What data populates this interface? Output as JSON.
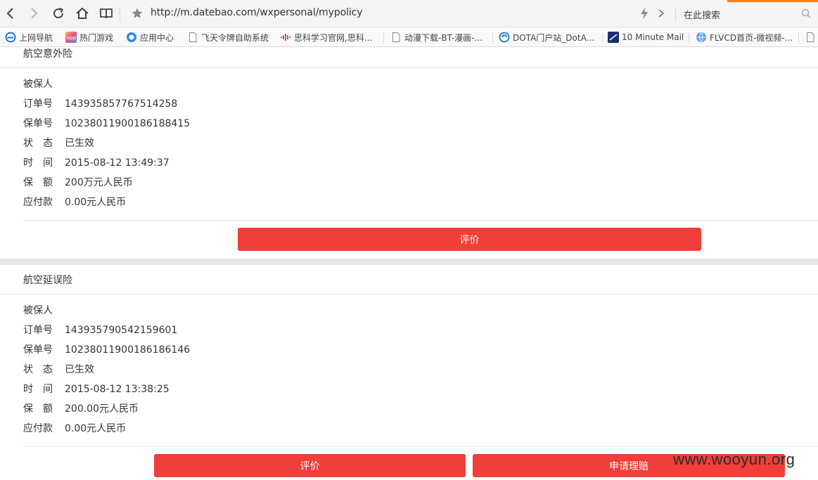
{
  "browser": {
    "url": "http://m.datebao.com/wxpersonal/mypolicy",
    "search_placeholder": "在此搜索",
    "bookmarks": [
      {
        "label": "上网导航",
        "icon": "ie-icon"
      },
      {
        "label": "热门游戏",
        "icon": "app-icon"
      },
      {
        "label": "应用中心",
        "icon": "app-center-icon"
      },
      {
        "label": "飞天令牌自助系统",
        "icon": "page-icon"
      },
      {
        "label": "思科学习官网,思科...",
        "icon": "cisco-icon"
      },
      {
        "label": "动漫下载-BT-漫画-...",
        "icon": "page-icon"
      },
      {
        "label": "DOTA门户站_DotA...",
        "icon": "dota-icon"
      },
      {
        "label": "10 Minute Mail",
        "icon": "mail-icon"
      },
      {
        "label": "FLVCD首页-微视频-...",
        "icon": "flvcd-icon"
      }
    ]
  },
  "policies": [
    {
      "title": "航空意外险",
      "fields": [
        {
          "label": "被保人",
          "value": ""
        },
        {
          "label": "订单号",
          "value": "143935857767514258"
        },
        {
          "label": "保单号",
          "value": "10238011900186188415"
        },
        {
          "label": "状　态",
          "value": "已生效"
        },
        {
          "label": "时　间",
          "value": "2015-08-12 13:49:37"
        },
        {
          "label": "保　额",
          "value": "200万元人民币"
        },
        {
          "label": "应付款",
          "value": "0.00元人民币"
        }
      ],
      "buttons": [
        "评价"
      ]
    },
    {
      "title": "航空延误险",
      "fields": [
        {
          "label": "被保人",
          "value": ""
        },
        {
          "label": "订单号",
          "value": "143935790542159601"
        },
        {
          "label": "保单号",
          "value": "10238011900186186146"
        },
        {
          "label": "状　态",
          "value": "已生效"
        },
        {
          "label": "时　间",
          "value": "2015-08-12 13:38:25"
        },
        {
          "label": "保　额",
          "value": "200.00元人民币"
        },
        {
          "label": "应付款",
          "value": "0.00元人民币"
        }
      ],
      "buttons": [
        "评价",
        "申请理赔"
      ]
    }
  ],
  "watermark": "www.wooyun.org",
  "colors": {
    "button": "#f03e3a",
    "separator": "#e8e6e3",
    "accent_strip": "#f57c1c"
  }
}
